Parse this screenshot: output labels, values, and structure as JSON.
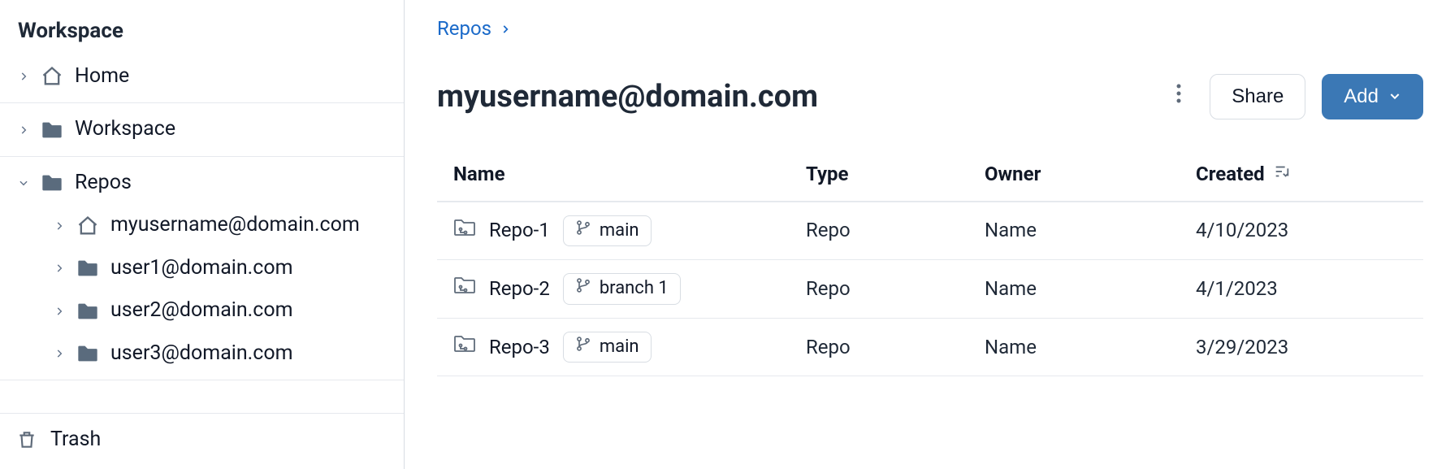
{
  "sidebar": {
    "title": "Workspace",
    "home_label": "Home",
    "workspace_label": "Workspace",
    "repos_label": "Repos",
    "repos_children": [
      {
        "label": "myusername@domain.com",
        "icon": "home"
      },
      {
        "label": "user1@domain.com",
        "icon": "folder"
      },
      {
        "label": "user2@domain.com",
        "icon": "folder"
      },
      {
        "label": "user3@domain.com",
        "icon": "folder"
      }
    ],
    "trash_label": "Trash"
  },
  "breadcrumb": {
    "items": [
      "Repos"
    ]
  },
  "header": {
    "title": "myusername@domain.com",
    "share_label": "Share",
    "add_label": "Add"
  },
  "table": {
    "columns": {
      "name": "Name",
      "type": "Type",
      "owner": "Owner",
      "created": "Created"
    },
    "rows": [
      {
        "name": "Repo-1",
        "branch": "main",
        "type": "Repo",
        "owner": "Name",
        "created": "4/10/2023"
      },
      {
        "name": "Repo-2",
        "branch": "branch 1",
        "type": "Repo",
        "owner": "Name",
        "created": "4/1/2023"
      },
      {
        "name": "Repo-3",
        "branch": "main",
        "type": "Repo",
        "owner": "Name",
        "created": "3/29/2023"
      }
    ]
  }
}
